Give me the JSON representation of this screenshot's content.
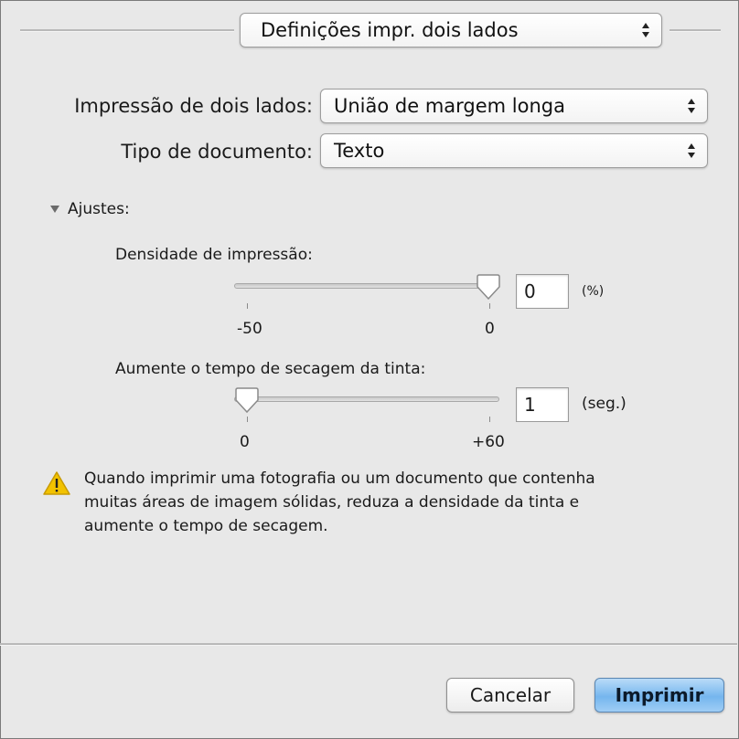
{
  "header": {
    "panel_popup": "Definições impr. dois lados"
  },
  "duplex": {
    "label": "Impressão de dois lados:",
    "value": "União de margem longa"
  },
  "doc_type": {
    "label": "Tipo de documento:",
    "value": "Texto"
  },
  "adjustments": {
    "label": "Ajustes:",
    "density": {
      "label": "Densidade de impressão:",
      "value": "0",
      "unit": "(%)",
      "min_label": "-50",
      "max_label": "0",
      "fraction": 1.0
    },
    "drying": {
      "label": "Aumente o tempo de secagem da tinta:",
      "value": "1",
      "unit": "(seg.)",
      "min_label": "0",
      "max_label": "+60",
      "fraction": 0.0
    }
  },
  "warning": {
    "line1": "Quando imprimir uma fotografia ou um documento que contenha",
    "line2": "muitas áreas de imagem sólidas, reduza a densidade da tinta e",
    "line3": "aumente o tempo de secagem."
  },
  "buttons": {
    "cancel": "Cancelar",
    "print": "Imprimir"
  },
  "colors": {
    "background": "#e8e8e8",
    "primary_button": "#75b6ee",
    "warning": "#f2c200"
  }
}
